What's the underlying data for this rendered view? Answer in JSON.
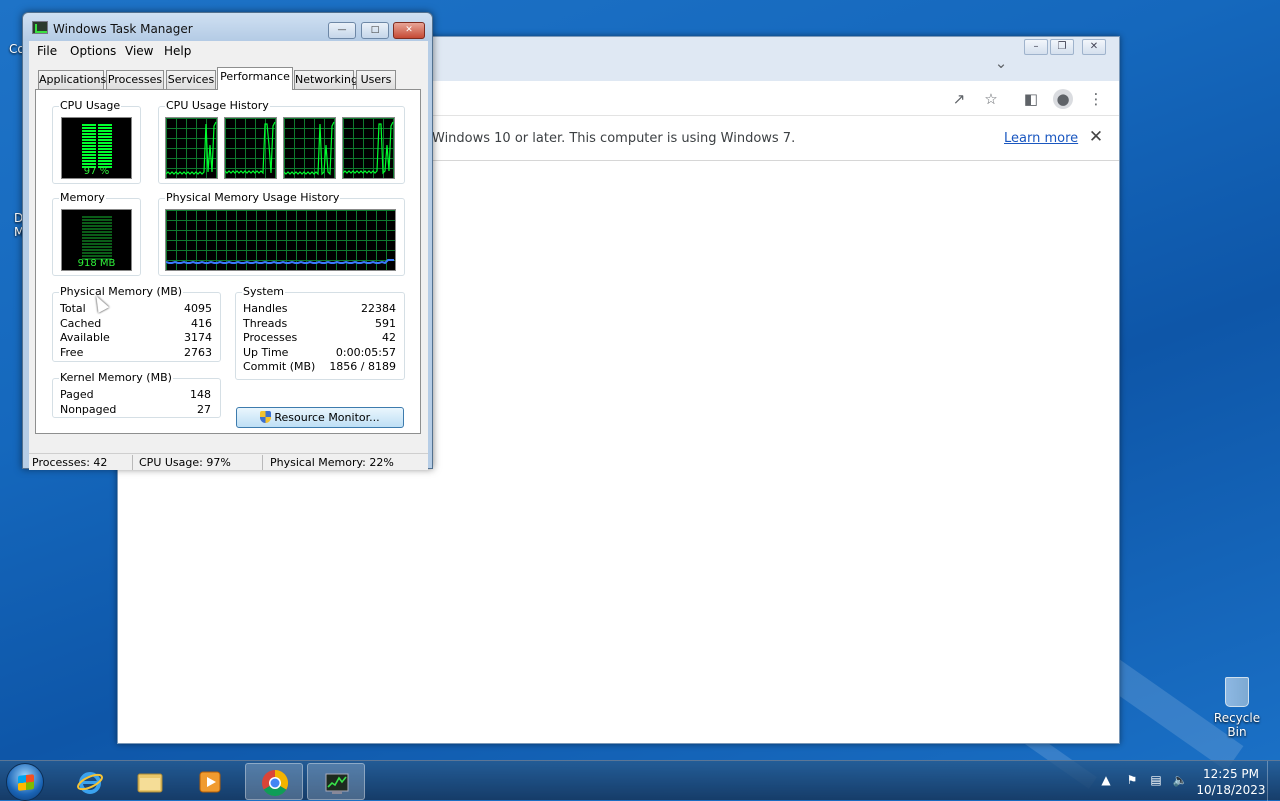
{
  "desktop": {
    "fragments": [
      "Co",
      "D",
      "M"
    ],
    "recycle_bin_label": "Recycle Bin"
  },
  "chrome": {
    "infobar_text": "Windows 10 or later. This computer is using Windows 7.",
    "learn_more": "Learn more"
  },
  "task_manager": {
    "title": "Windows Task Manager",
    "menu": [
      "File",
      "Options",
      "View",
      "Help"
    ],
    "tabs": [
      "Applications",
      "Processes",
      "Services",
      "Performance",
      "Networking",
      "Users"
    ],
    "active_tab": "Performance",
    "cpu_usage_label": "CPU Usage",
    "cpu_usage_value": "97 %",
    "cpu_history_label": "CPU Usage History",
    "memory_label": "Memory",
    "memory_value": "918 MB",
    "memory_history_label": "Physical Memory Usage History",
    "physical_memory": {
      "title": "Physical Memory (MB)",
      "rows": [
        {
          "label": "Total",
          "value": "4095"
        },
        {
          "label": "Cached",
          "value": "416"
        },
        {
          "label": "Available",
          "value": "3174"
        },
        {
          "label": "Free",
          "value": "2763"
        }
      ]
    },
    "kernel_memory": {
      "title": "Kernel Memory (MB)",
      "rows": [
        {
          "label": "Paged",
          "value": "148"
        },
        {
          "label": "Nonpaged",
          "value": "27"
        }
      ]
    },
    "system": {
      "title": "System",
      "rows": [
        {
          "label": "Handles",
          "value": "22384"
        },
        {
          "label": "Threads",
          "value": "591"
        },
        {
          "label": "Processes",
          "value": "42"
        },
        {
          "label": "Up Time",
          "value": "0:00:05:57"
        },
        {
          "label": "Commit (MB)",
          "value": "1856 / 8189"
        }
      ]
    },
    "resource_monitor_button": "Resource Monitor...",
    "status": {
      "processes": "Processes: 42",
      "cpu": "CPU Usage: 97%",
      "memory": "Physical Memory: 22%"
    },
    "colors": {
      "graph_line": "#00ff2e",
      "grid": "#0f7a2e",
      "memory_line": "#3a7bff"
    }
  },
  "taskbar": {
    "pinned": [
      "internet-explorer",
      "windows-explorer",
      "media-player",
      "chrome",
      "task-manager"
    ],
    "clock_time": "12:25 PM",
    "clock_date": "10/18/2023"
  }
}
